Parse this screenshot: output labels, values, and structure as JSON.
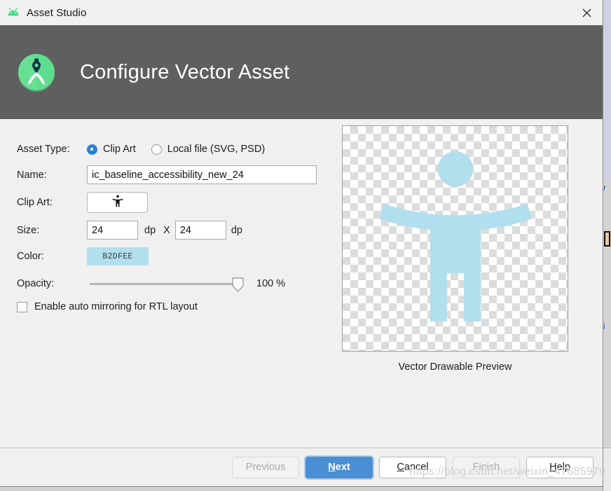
{
  "window": {
    "title": "Asset Studio",
    "app_icon": "android-robot-icon",
    "close_label": "✕"
  },
  "banner": {
    "logo": "android-studio-logo",
    "title": "Configure Vector Asset"
  },
  "form": {
    "asset_type": {
      "label": "Asset Type:",
      "options": [
        {
          "label": "Clip Art",
          "selected": true
        },
        {
          "label": "Local file (SVG, PSD)",
          "selected": false
        }
      ]
    },
    "name": {
      "label": "Name:",
      "value": "ic_baseline_accessibility_new_24",
      "placeholder": ""
    },
    "clip_art": {
      "label": "Clip Art:",
      "icon": "accessibility-icon"
    },
    "size": {
      "label": "Size:",
      "width_value": "24",
      "height_value": "24",
      "unit_1": "dp",
      "separator": "X",
      "unit_2": "dp"
    },
    "color": {
      "label": "Color:",
      "value": "B2DFEE",
      "hex": "#B2DFEE"
    },
    "opacity": {
      "label": "Opacity:",
      "value": "100 %",
      "percent": 100
    },
    "mirroring": {
      "label": "Enable auto mirroring for RTL layout",
      "checked": false
    }
  },
  "preview": {
    "caption": "Vector Drawable Preview",
    "icon": "accessibility-icon",
    "icon_color": "#B2DFEE"
  },
  "footer": {
    "buttons": [
      {
        "label": "Previous",
        "state": "disabled",
        "mnemonic": ""
      },
      {
        "label": "Next",
        "state": "default",
        "mnemonic": "N"
      },
      {
        "label": "Cancel",
        "state": "normal",
        "mnemonic": "C"
      },
      {
        "label": "Finish",
        "state": "disabled",
        "mnemonic": ""
      },
      {
        "label": "Help",
        "state": "normal",
        "mnemonic": "H"
      }
    ]
  },
  "watermark": {
    "text": "https://blog.csdn.net/weixin_47685979"
  },
  "background_window": {
    "fragments": [
      "r",
      "i"
    ]
  }
}
